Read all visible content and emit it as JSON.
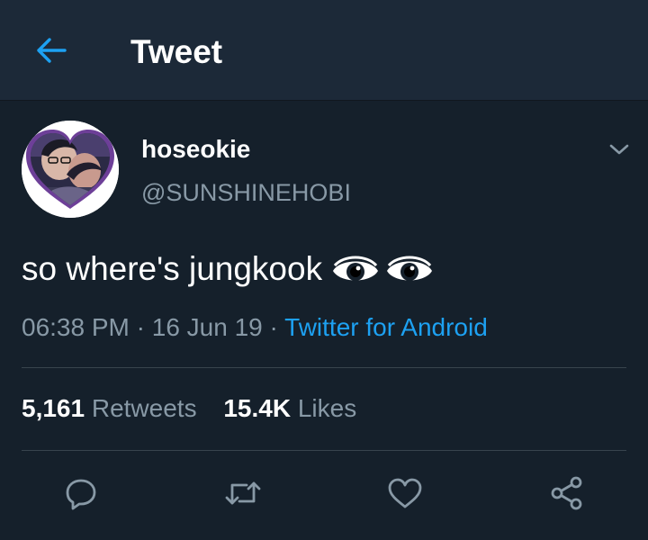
{
  "header": {
    "title": "Tweet",
    "back_icon": "arrow-left-icon"
  },
  "author": {
    "display_name": "hoseokie",
    "handle": "@SUNSHINEHOBI"
  },
  "tweet": {
    "text": "so where's jungkook",
    "emojis": [
      "eye-icon",
      "eye-icon"
    ]
  },
  "meta": {
    "time": "06:38 PM",
    "sep1": " · ",
    "date": "16 Jun 19",
    "sep2": " · ",
    "source": "Twitter for Android"
  },
  "stats": {
    "retweets_count": "5,161",
    "retweets_label": "Retweets",
    "likes_count": "15.4K",
    "likes_label": "Likes"
  },
  "colors": {
    "background": "#15202b",
    "header_background": "#1c2938",
    "accent": "#1da1f2",
    "secondary_text": "#8899a6",
    "divider": "#38444d"
  }
}
